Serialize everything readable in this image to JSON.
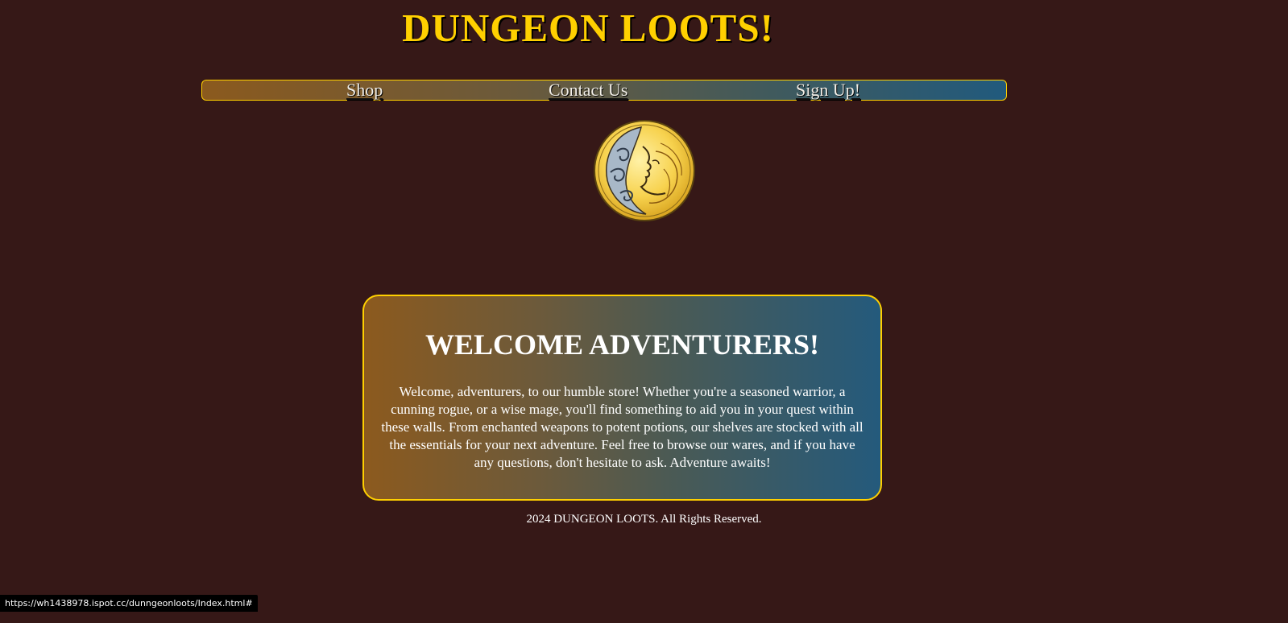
{
  "header": {
    "title": "DUNGEON LOOTS!",
    "title_color": "#ffd000"
  },
  "nav": {
    "items": [
      {
        "label": "Shop"
      },
      {
        "label": "Contact Us"
      },
      {
        "label": "Sign Up!"
      }
    ],
    "border_color": "#ffd000"
  },
  "logo": {
    "icon": "golden-crescent-moon-face-emblem-icon"
  },
  "welcome": {
    "heading": "WELCOME ADVENTURERS!",
    "body": "Welcome, adventurers, to our humble store! Whether you're a seasoned warrior, a cunning rogue, or a wise mage, you'll find something to aid you in your quest within these walls. From enchanted weapons to potent potions, our shelves are stocked with all the essentials for your next adventure. Feel free to browse our wares, and if you have any questions, don't hesitate to ask. Adventure awaits!"
  },
  "footer": {
    "text": "2024 DUNGEON LOOTS. All Rights Reserved."
  },
  "status_bar": {
    "url": "https://wh1438978.ispot.cc/dunngeonloots/Index.html#"
  },
  "colors": {
    "background": "#361817",
    "accent": "#ffd000",
    "gradient_start": "#8c5a1e",
    "gradient_end": "#245a7c"
  }
}
